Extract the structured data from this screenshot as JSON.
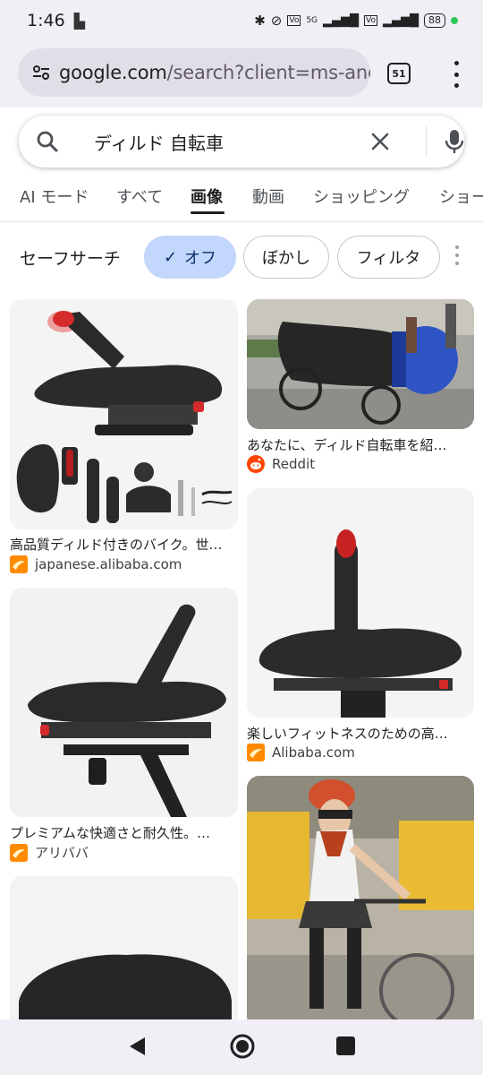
{
  "status_bar": {
    "time": "1:46",
    "network_label": "5G",
    "battery": "88"
  },
  "browser": {
    "url_domain": "google.com",
    "url_path": "/search?client=ms-andr",
    "tab_count": "51"
  },
  "search": {
    "query": "ディルド 自転車"
  },
  "tabs": [
    {
      "label": "AI モード"
    },
    {
      "label": "すべて"
    },
    {
      "label": "画像",
      "active": true
    },
    {
      "label": "動画"
    },
    {
      "label": "ショッピング"
    },
    {
      "label": "ショー"
    }
  ],
  "filters": {
    "safe_search_label": "セーフサーチ",
    "chips": [
      {
        "label": "オフ",
        "selected": true
      },
      {
        "label": "ぼかし"
      },
      {
        "label": "フィルタ"
      }
    ]
  },
  "results": [
    {
      "title": "高品質ディルド付きのバイク。世…",
      "source": "japanese.alibaba.com",
      "favicon": "alibaba-icon"
    },
    {
      "title": "あなたに、ディルド自転車を紹…",
      "source": "Reddit",
      "favicon": "reddit-icon"
    },
    {
      "title": "プレミアムな快適さと耐久性。…",
      "source": "アリババ",
      "favicon": "alibaba-icon"
    },
    {
      "title": "楽しいフィットネスのための高…",
      "source": "Alibaba.com",
      "favicon": "alibaba-icon"
    }
  ],
  "colors": {
    "chrome_bg": "#f1eef5",
    "chip_selected": "#c2d7fb",
    "alibaba_orange": "#ff6a00",
    "reddit_orange": "#ff4500"
  }
}
